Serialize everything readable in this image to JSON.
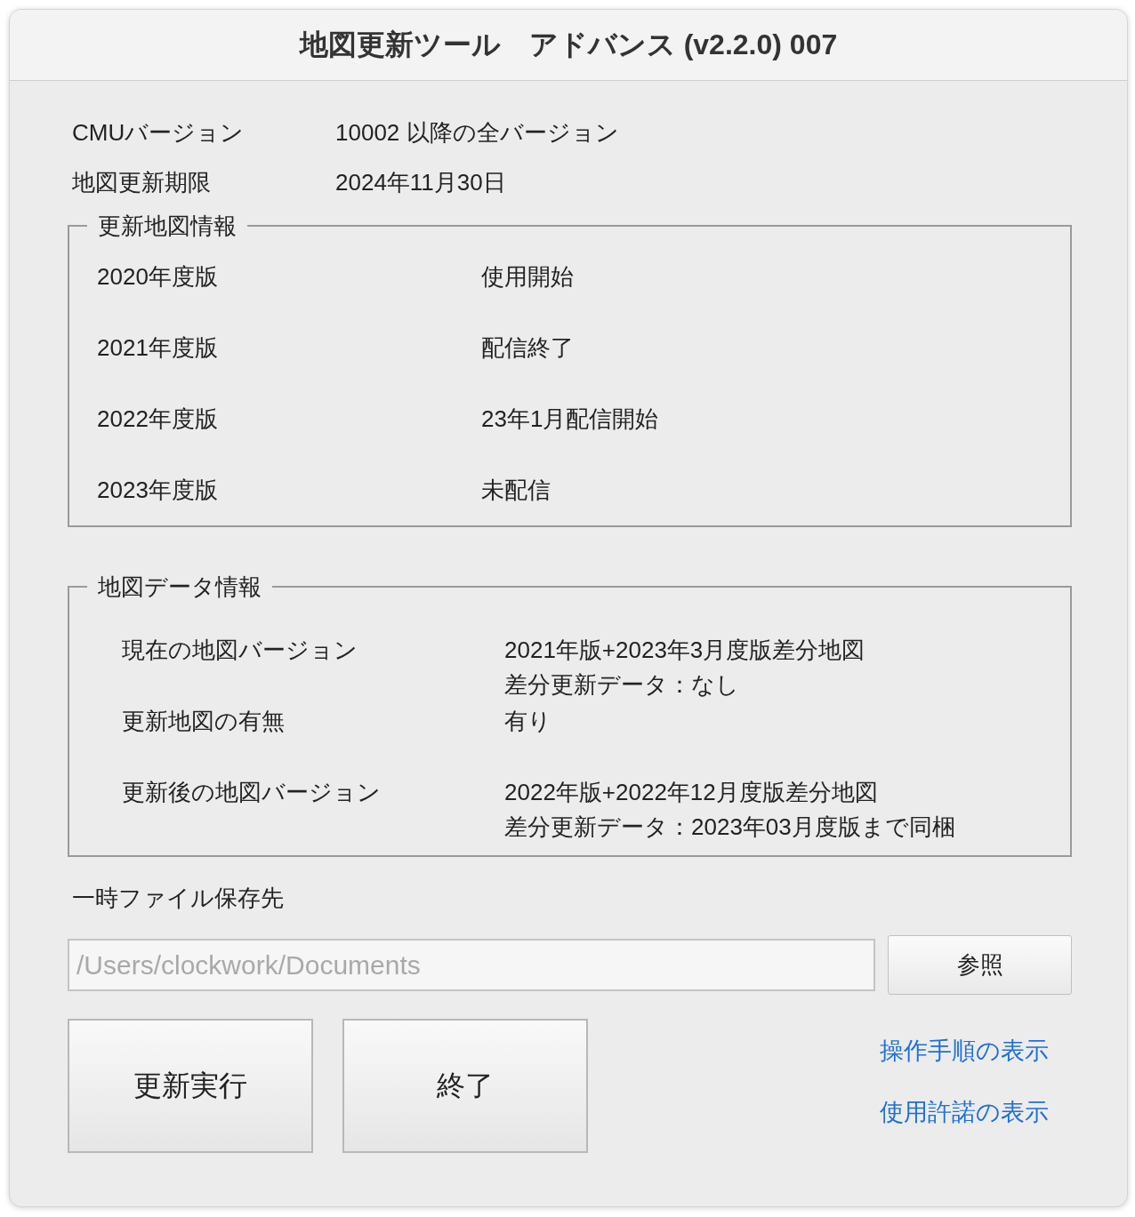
{
  "window": {
    "title": "地図更新ツール　アドバンス (v2.2.0) 007"
  },
  "info": [
    {
      "label": "CMUバージョン",
      "value": "10002 以降の全バージョン"
    },
    {
      "label": "地図更新期限",
      "value": "2024年11月30日"
    }
  ],
  "update_map_info": {
    "title": "更新地図情報",
    "rows": [
      {
        "edition": "2020年度版",
        "status": "使用開始"
      },
      {
        "edition": "2021年度版",
        "status": "配信終了"
      },
      {
        "edition": "2022年度版",
        "status": "23年1月配信開始"
      },
      {
        "edition": "2023年度版",
        "status": "未配信"
      }
    ]
  },
  "map_data_info": {
    "title": "地図データ情報",
    "rows": [
      {
        "label": "現在の地図バージョン",
        "lines": [
          "2021年版+2023年3月度版差分地図",
          "差分更新データ：なし"
        ]
      },
      {
        "label": "更新地図の有無",
        "lines": [
          "有り"
        ]
      },
      {
        "label": "更新後の地図バージョン",
        "lines": [
          "2022年版+2022年12月度版差分地図",
          "差分更新データ：2023年03月度版まで同梱"
        ]
      }
    ]
  },
  "temp_folder": {
    "label": "一時ファイル保存先",
    "path": {
      "value": "/Users/clockwork/Documents",
      "disabled": true
    },
    "browse_button": "参照"
  },
  "buttons": [
    "更新実行",
    "終了"
  ],
  "links": [
    "操作手順の表示",
    "使用許諾の表示"
  ]
}
